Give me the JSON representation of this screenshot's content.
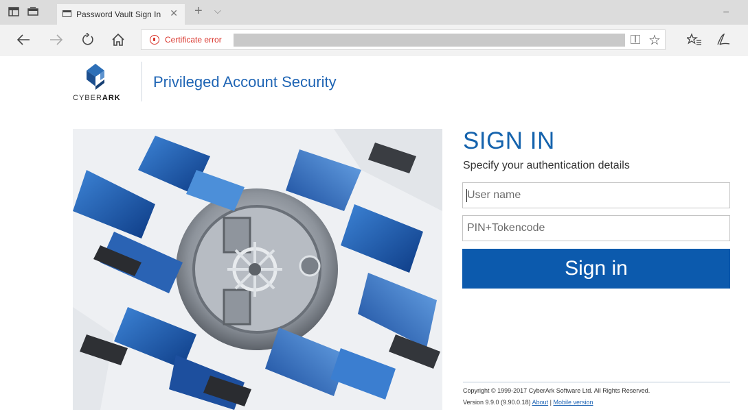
{
  "browser": {
    "tab_title": "Password Vault Sign In",
    "tab_close": "✕",
    "new_tab": "+",
    "tab_overflow": "⌵",
    "minimize": "–",
    "address_warning": "Certificate error",
    "icons": [
      "tab-preview-icon",
      "set-aside-tabs-icon",
      "page-icon",
      "back-icon",
      "forward-icon",
      "refresh-icon",
      "home-icon",
      "certificate-error-icon",
      "reading-view-icon",
      "favorite-star-icon",
      "favorites-hub-icon",
      "web-note-icon"
    ]
  },
  "header": {
    "logo_text_light": "CYBER",
    "logo_text_bold": "ARK",
    "app_title": "Privileged Account Security"
  },
  "signin": {
    "title": "SIGN IN",
    "subtitle": "Specify your authentication details",
    "username_placeholder": "User name",
    "pin_placeholder": "PIN+Tokencode",
    "button_label": "Sign in"
  },
  "footer": {
    "copyright": "Copyright © 1999-2017 CyberArk Software Ltd. All Rights Reserved.",
    "version": "Version 9.9.0 (9.90.0.18)",
    "about_link": "About",
    "separator": "|",
    "mobile_link": "Mobile version"
  },
  "colors": {
    "brand_blue": "#1563ad",
    "button_blue": "#0c5aad",
    "error_red": "#d9342b"
  }
}
